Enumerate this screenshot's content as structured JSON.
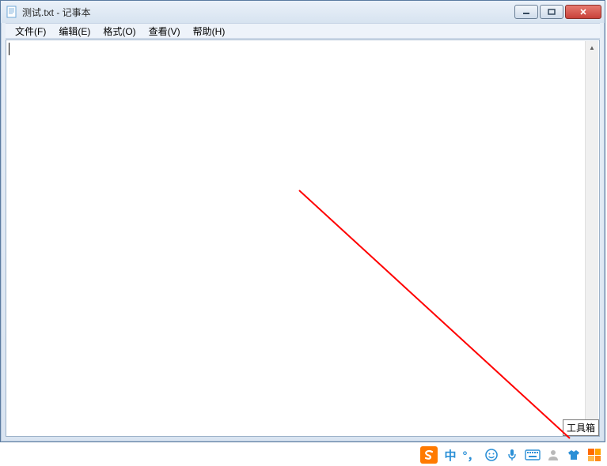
{
  "window": {
    "title": "测试.txt - 记事本"
  },
  "menu": {
    "file": "文件(F)",
    "edit": "编辑(E)",
    "format": "格式(O)",
    "view": "查看(V)",
    "help": "帮助(H)"
  },
  "editor": {
    "content": ""
  },
  "tooltip": {
    "label": "工具箱"
  },
  "ime": {
    "mode_char": "中"
  }
}
